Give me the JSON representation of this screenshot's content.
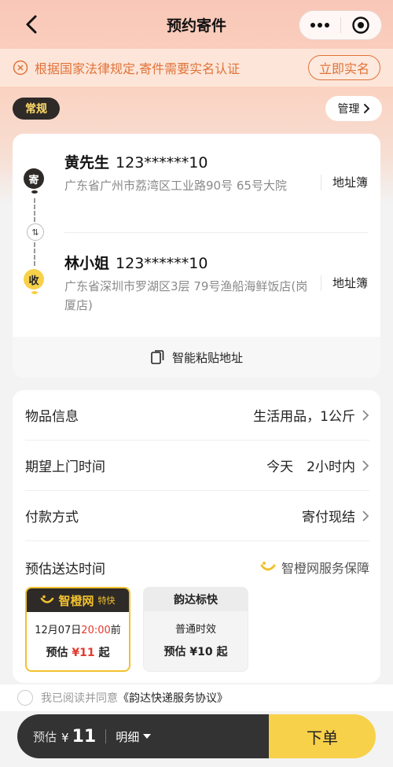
{
  "nav": {
    "title": "预约寄件"
  },
  "notice": {
    "text": "根据国家法律规定,寄件需要实名认证",
    "button": "立即实名"
  },
  "tag": "常规",
  "manage": "管理",
  "sender": {
    "badge": "寄",
    "name": "黄先生",
    "phone": "123******10",
    "address": "广东省广州市荔湾区工业路90号 65号大院",
    "book": "地址簿"
  },
  "receiver": {
    "badge": "收",
    "name": "林小姐",
    "phone": "123******10",
    "address": "广东省深圳市罗湖区3层 79号渔船海鲜饭店(岗厦店)",
    "book": "地址簿"
  },
  "swap_icon": "⇅",
  "paste": "智能粘贴地址",
  "rows": [
    {
      "label": "物品信息",
      "value": "生活用品，1公斤"
    },
    {
      "label": "期望上门时间",
      "value": "今天　2小时内"
    },
    {
      "label": "付款方式",
      "value": "寄付现结"
    }
  ],
  "estimate": {
    "label": "预估送达时间",
    "guarantee": "智橙网服务保障"
  },
  "options": [
    {
      "brand": "智橙网",
      "tag": "特快",
      "date": "12月07日",
      "time": "20:00",
      "suffix": "前",
      "price_prefix": "预估",
      "price": "¥11",
      "price_suffix": "起"
    },
    {
      "brand": "韵达标快",
      "line": "普通时效",
      "price": "预估 ¥10 起"
    }
  ],
  "agreement": {
    "text": "我已阅读并同意",
    "link": "《韵达快递服务协议》"
  },
  "bottom": {
    "estimate": "预估",
    "currency": "¥",
    "amount": "11",
    "detail": "明细",
    "order": "下单"
  },
  "colors": {
    "accent": "#f7d14a",
    "notice": "#e0733a",
    "dark": "#2e2a27",
    "red": "#e23a2e"
  }
}
